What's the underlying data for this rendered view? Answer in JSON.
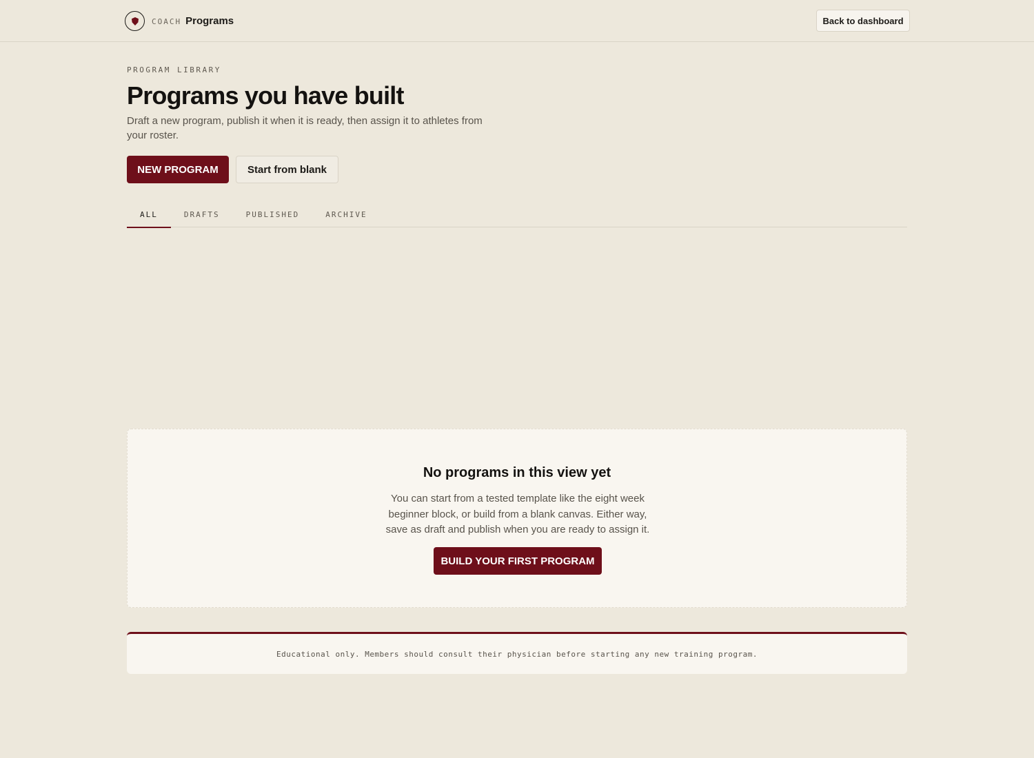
{
  "header": {
    "logo_icon": "shield-icon",
    "brand_small": "COACH",
    "brand_title": "Programs",
    "back_label": "Back to dashboard"
  },
  "page": {
    "eyebrow": "PROGRAM LIBRARY",
    "title": "Programs you have built",
    "description": "Draft a new program, publish it when it is ready, then assign it to athletes from your roster."
  },
  "actions": {
    "new_program": "NEW PROGRAM",
    "start_blank": "Start from blank"
  },
  "tabs": [
    {
      "label": "ALL",
      "active": true
    },
    {
      "label": "DRAFTS",
      "active": false
    },
    {
      "label": "PUBLISHED",
      "active": false
    },
    {
      "label": "ARCHIVE",
      "active": false
    }
  ],
  "empty_state": {
    "title": "No programs in this view yet",
    "description": "You can start from a tested template like the eight week beginner block, or build from a blank canvas. Either way, save as draft and publish when you are ready to assign it.",
    "cta": "BUILD YOUR FIRST PROGRAM"
  },
  "footer": {
    "disclaimer": "Educational only. Members should consult their physician before starting any new training program."
  },
  "colors": {
    "accent": "#6e0f1a",
    "background": "#ede8dc",
    "card": "#f9f6f0"
  }
}
